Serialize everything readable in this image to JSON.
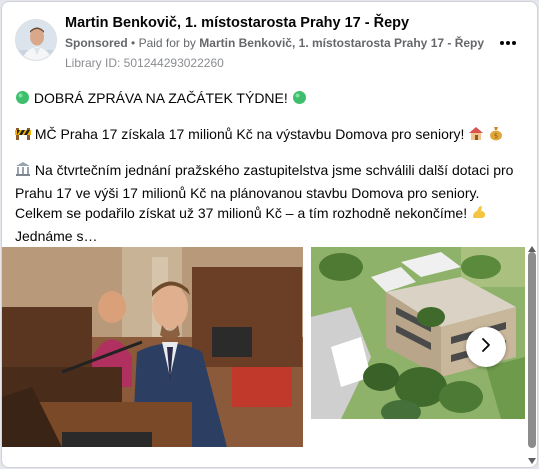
{
  "post": {
    "page_name": "Martin Benkovič, 1. místostarosta Prahy 17 - Řepy",
    "sponsored_label": "Sponsored",
    "paid_for_prefix": "Paid for by",
    "paid_for_name": "Martin Benkovič, 1. místostarosta Prahy 17 - Řepy",
    "library_id": "Library ID: 501244293022260",
    "more_icon": "more-horizontal-icon"
  },
  "body": {
    "line1": "DOBRÁ ZPRÁVA NA ZAČÁTEK TÝDNE!",
    "line2": "MČ Praha 17 získala 17 milionů Kč na výstavbu Domova pro seniory!",
    "line3": "Na čtvrtečním jednání pražského zastupitelstva jsme schválili další dotaci pro Prahu 17 ve výši 17 milionů Kč na plánovanou stavbu Domova pro seniory. Celkem se podařilo získat už 37 milionů Kč – a tím rozhodně nekončíme!",
    "line3_tail": "Jednáme s…"
  },
  "media": {
    "next_icon": "chevron-right-icon"
  },
  "colors": {
    "text": "#050505",
    "secondary": "#65676b",
    "green_dot": "#2ecc71"
  }
}
